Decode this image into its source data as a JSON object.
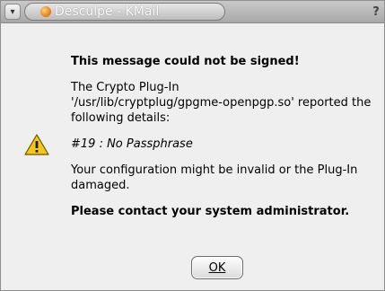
{
  "window": {
    "title": "Desculpe - KMail",
    "help_label": "?",
    "menu_glyph": "▾"
  },
  "dialog": {
    "heading": "This message could not be signed!",
    "body_line1": "The Crypto Plug-In",
    "body_line2": "'/usr/lib/cryptplug/gpgme-openpgp.so' reported the",
    "body_line3": "following details:",
    "error_detail": "#19 : No Passphrase",
    "body2_line1": "Your configuration might be invalid or the Plug-In",
    "body2_line2": "damaged.",
    "contact": "Please contact your system administrator.",
    "ok_label": "OK",
    "icon": "warning-icon"
  },
  "colors": {
    "window_bg": "#efefef",
    "warning_fill": "#f2c81a"
  }
}
